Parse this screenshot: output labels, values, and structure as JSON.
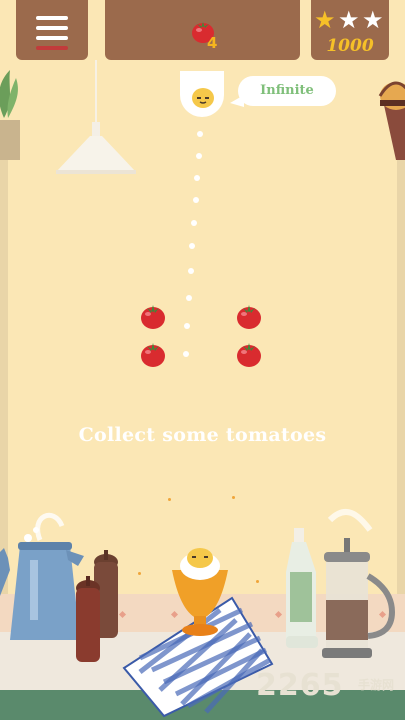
{
  "hud": {
    "menu_icon": "hamburger-menu-icon",
    "tomatoes_remaining": "4",
    "tomato_icon": "tomato-icon",
    "stars_earned": 1,
    "stars_total": 3,
    "score": "1000"
  },
  "character": {
    "bubble_text": "Infinite"
  },
  "level": {
    "instruction": "Collect some tomatoes",
    "tomatoes_on_board": 4
  },
  "watermark": {
    "text": "2265",
    "sub": "手游网"
  },
  "colors": {
    "background": "#fbe7b5",
    "panel": "#9b6a4c",
    "panel_shadow": "#b4303c",
    "score_gold": "#f6c028",
    "bubble_text": "#7fbf7a",
    "tomato_red": "#d92b2f",
    "counter_green": "#5a8a6c"
  }
}
